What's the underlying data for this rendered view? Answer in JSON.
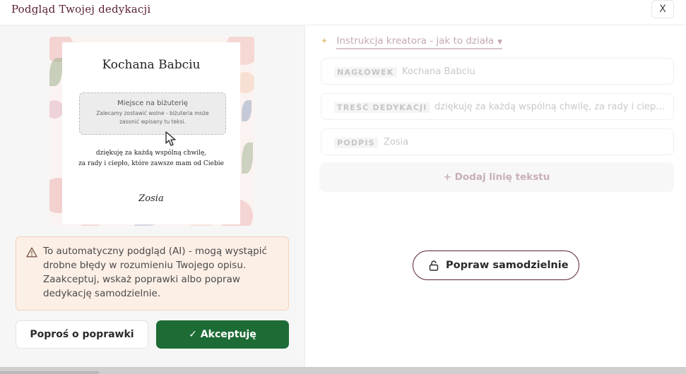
{
  "header": {
    "title": "Podgląd Twojej dedykacji",
    "close_label": "X"
  },
  "preview": {
    "heading": "Kochana Babciu",
    "jewelry_title": "Miejsce na biżuterię",
    "jewelry_note": "Zalecamy zostawić wolne - biżuteria może zasonić wpisany tu teksi.",
    "body_line1": "dziękuję za każdą wspólną chwilę,",
    "body_line2": "za rady i ciepło, które zawsze mam od Ciebie",
    "signature": "Zosia"
  },
  "notice": {
    "text": "To automatyczny podgląd (AI) - mogą wystąpić drobne błędy w rozumieniu Twojego opisu. Zaakceptuj, wskaż poprawki albo popraw dedykację samodzielnie."
  },
  "actions": {
    "request_fix_label": "Poproś o poprawki",
    "accept_label": "✓ Akceptuję"
  },
  "editor": {
    "instructions_label": "Instrukcja kreatora - jak to działa",
    "fields": [
      {
        "label": "NAGŁÓWEK",
        "value": "Kochana Babciu"
      },
      {
        "label": "TREŚĆ DEDYKACJI",
        "value": "dziękuję za każdą wspólną chwilę, za rady i ciepło..."
      },
      {
        "label": "PODPIS",
        "value": "Zosia"
      }
    ],
    "add_line_label": "+ Dodaj linię tekstu",
    "fix_self_label": "Popraw samodzielnie"
  },
  "colors": {
    "brand": "#5a1f34",
    "accept": "#1d6b35",
    "notice_bg": "#fcefe6"
  }
}
